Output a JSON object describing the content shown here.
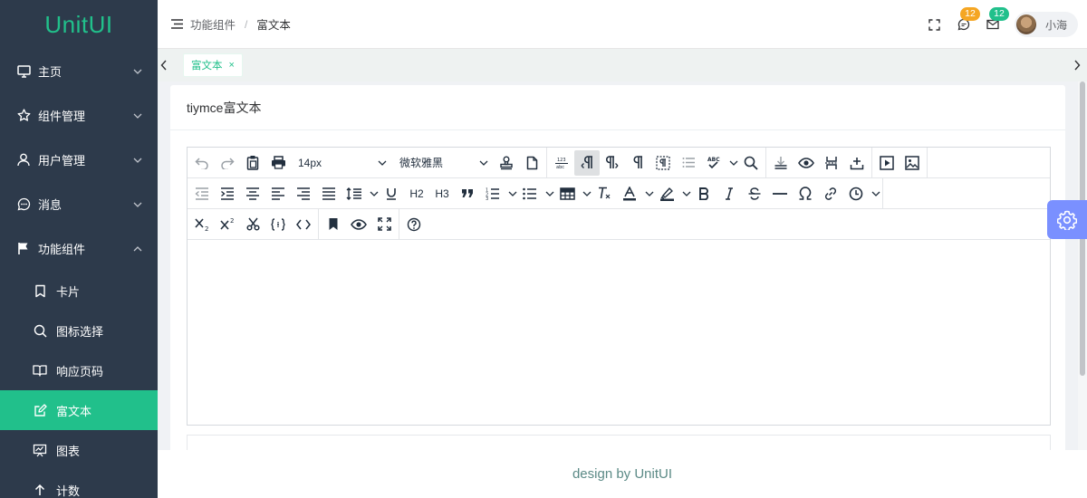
{
  "app": {
    "logo": "UnitUI"
  },
  "sidebar": {
    "items": [
      {
        "label": "主页",
        "icon": "monitor-icon"
      },
      {
        "label": "组件管理",
        "icon": "star-icon"
      },
      {
        "label": "用户管理",
        "icon": "user-icon"
      },
      {
        "label": "消息",
        "icon": "chat-icon"
      },
      {
        "label": "功能组件",
        "icon": "flag-icon"
      }
    ],
    "subitems": [
      {
        "label": "卡片",
        "icon": "bookmark-icon"
      },
      {
        "label": "图标选择",
        "icon": "search-icon"
      },
      {
        "label": "响应页码",
        "icon": "book-icon"
      },
      {
        "label": "富文本",
        "icon": "edit-icon"
      },
      {
        "label": "图表",
        "icon": "chart-icon"
      },
      {
        "label": "计数",
        "icon": "arrow-up-icon"
      }
    ],
    "active_subitem": "富文本",
    "active_color": "#21c08b",
    "background": "#2d3a4b"
  },
  "header": {
    "breadcrumb": [
      "功能组件",
      "富文本"
    ],
    "breadcrumb_separator": "/",
    "badges": {
      "messages": "12",
      "mail": "12"
    },
    "badge_colors": {
      "messages": "#f5a623",
      "mail": "#21c08b"
    },
    "user_name": "小海"
  },
  "tabs": [
    {
      "label": "富文本",
      "close": "×"
    }
  ],
  "panel": {
    "title": "tiymce富文本"
  },
  "editor": {
    "font_size": "14px",
    "font_family": "微软雅黑",
    "row2_labels": {
      "h2": "H2",
      "h3": "H3"
    }
  },
  "footer": {
    "text": "design by UnitUI"
  }
}
